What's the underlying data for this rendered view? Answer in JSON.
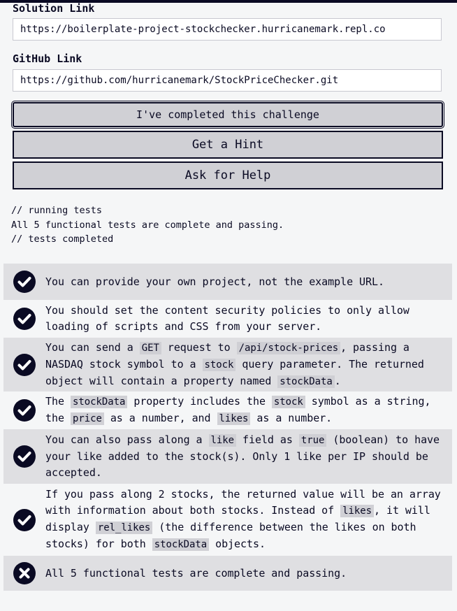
{
  "solution": {
    "label": "Solution Link",
    "value": "https://boilerplate-project-stockchecker.hurricanemark.repl.co"
  },
  "github": {
    "label": "GitHub Link",
    "value": "https://github.com/hurricanemark/StockPriceChecker.git"
  },
  "buttons": {
    "complete": "I've completed this challenge",
    "hint": "Get a Hint",
    "help": "Ask for Help"
  },
  "console": {
    "lines": [
      "// running tests",
      "All 5 functional tests are complete and passing.",
      "// tests completed"
    ]
  },
  "tests": [
    {
      "status": "pass",
      "parts": [
        {
          "t": "You can provide your own project, not the example URL."
        }
      ]
    },
    {
      "status": "pass",
      "parts": [
        {
          "t": "You should set the content security policies to only allow loading of scripts and CSS from your server."
        }
      ]
    },
    {
      "status": "pass",
      "parts": [
        {
          "t": "You can send a "
        },
        {
          "c": "GET"
        },
        {
          "t": " request to "
        },
        {
          "c": "/api/stock-prices"
        },
        {
          "t": ", passing a NASDAQ stock symbol to a "
        },
        {
          "c": "stock"
        },
        {
          "t": " query parameter. The returned object will contain a property named "
        },
        {
          "c": "stockData"
        },
        {
          "t": "."
        }
      ]
    },
    {
      "status": "pass",
      "parts": [
        {
          "t": "The "
        },
        {
          "c": "stockData"
        },
        {
          "t": " property includes the "
        },
        {
          "c": "stock"
        },
        {
          "t": " symbol as a string, the "
        },
        {
          "c": "price"
        },
        {
          "t": " as a number, and "
        },
        {
          "c": "likes"
        },
        {
          "t": " as a number."
        }
      ]
    },
    {
      "status": "pass",
      "parts": [
        {
          "t": "You can also pass along a "
        },
        {
          "c": "like"
        },
        {
          "t": " field as "
        },
        {
          "c": "true"
        },
        {
          "t": " (boolean) to have your like added to the stock(s). Only 1 like per IP should be accepted."
        }
      ]
    },
    {
      "status": "pass",
      "parts": [
        {
          "t": "If you pass along 2 stocks, the returned value will be an array with information about both stocks. Instead of "
        },
        {
          "c": "likes"
        },
        {
          "t": ", it will display "
        },
        {
          "c": "rel_likes"
        },
        {
          "t": " (the difference between the likes on both stocks) for both "
        },
        {
          "c": "stockData"
        },
        {
          "t": " objects."
        }
      ]
    },
    {
      "status": "fail",
      "parts": [
        {
          "t": "All 5 functional tests are complete and passing."
        }
      ]
    }
  ],
  "colors": {
    "text": "#0a0a23",
    "shaded_row": "#dfdfe2",
    "button_bg": "#d0d0d5"
  },
  "icons": {
    "pass": "check-circle-icon",
    "fail": "x-circle-icon"
  }
}
